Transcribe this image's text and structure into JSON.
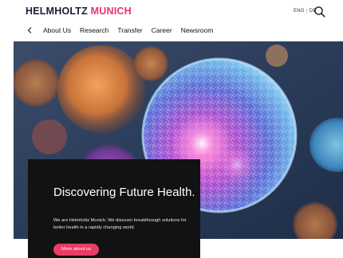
{
  "header": {
    "logo_part1": "HELMHOLTZ",
    "logo_part2": "MUNICH",
    "lang_en": "ENG",
    "lang_separator": "|",
    "lang_de": "DE",
    "search_icon": "search-icon"
  },
  "nav": {
    "back_icon": "chevron-left-icon",
    "items": [
      {
        "label": "About Us"
      },
      {
        "label": "Research"
      },
      {
        "label": "Transfer"
      },
      {
        "label": "Career"
      },
      {
        "label": "Newsroom"
      }
    ]
  },
  "hero": {
    "image": "cell-microscopy-illustration",
    "title": "Discovering Future Health.",
    "subtitle": "We are Helmholtz Munich. We discover breakthrough solutions for better health in a rapidly changing world.",
    "button_label": "More about us"
  },
  "colors": {
    "brand_dark": "#1b1b3a",
    "brand_pink": "#e8336f",
    "button": "#e93d66",
    "panel": "#121212"
  }
}
